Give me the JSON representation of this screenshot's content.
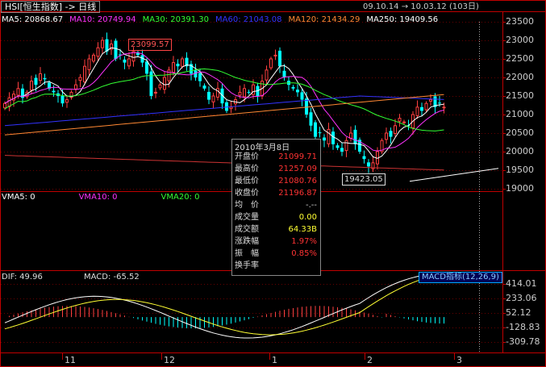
{
  "header": {
    "title": "HSI[恒生指数] -> 日线",
    "date_range": "09.10.14 → 10.03.12 (103日)"
  },
  "ma_legend": [
    {
      "label": "MA5: 20868.67",
      "color": "#ffffff"
    },
    {
      "label": "MA10: 20749.94",
      "color": "#ff33ff"
    },
    {
      "label": "MA30: 20391.30",
      "color": "#33ff33"
    },
    {
      "label": "MA60: 21043.08",
      "color": "#3333ff"
    },
    {
      "label": "MA120: 21434.29",
      "color": "#ff8833"
    },
    {
      "label": "MA250: 19409.56",
      "color": "#ffffff"
    }
  ],
  "price_axis": [
    "23500",
    "23000",
    "22500",
    "22000",
    "21500",
    "21000",
    "20500",
    "20000",
    "19500",
    "19000"
  ],
  "annotations": {
    "high": "23099.57",
    "low": "19423.05"
  },
  "volume_legend": [
    {
      "label": "VMA5: 0",
      "color": "#ffffff"
    },
    {
      "label": "VMA10: 0",
      "color": "#ff33ff"
    },
    {
      "label": "VMA20: 0",
      "color": "#33ff33"
    }
  ],
  "macd_legend": {
    "dif": "DIF: 49.96",
    "macd": "MACD: -65.52",
    "indicator": "MACD指标(12,26,9)"
  },
  "macd_axis": [
    "414.01",
    "233.06",
    "52.12",
    "-128.83",
    "-309.78"
  ],
  "x_axis": [
    "11",
    "12",
    "1",
    "2",
    "3"
  ],
  "tooltip": {
    "date": "2010年3月8日",
    "rows": [
      {
        "label": "开盘价",
        "value": "21099.71",
        "color": "#ff3333"
      },
      {
        "label": "最高价",
        "value": "21257.09",
        "color": "#ff3333"
      },
      {
        "label": "最低价",
        "value": "21080.76",
        "color": "#ff3333"
      },
      {
        "label": "收盘价",
        "value": "21196.87",
        "color": "#ff3333"
      },
      {
        "label": "均　价",
        "value": "-.--",
        "color": "#cccccc"
      },
      {
        "label": "成交量",
        "value": "0.00",
        "color": "#ffff33"
      },
      {
        "label": "成交额",
        "value": "64.33B",
        "color": "#ffff33"
      },
      {
        "label": "涨跌幅",
        "value": "1.97%",
        "color": "#ff3333"
      },
      {
        "label": "振　幅",
        "value": "0.85%",
        "color": "#ff3333"
      },
      {
        "label": "换手率",
        "value": "",
        "color": "#cccccc"
      }
    ]
  }
}
